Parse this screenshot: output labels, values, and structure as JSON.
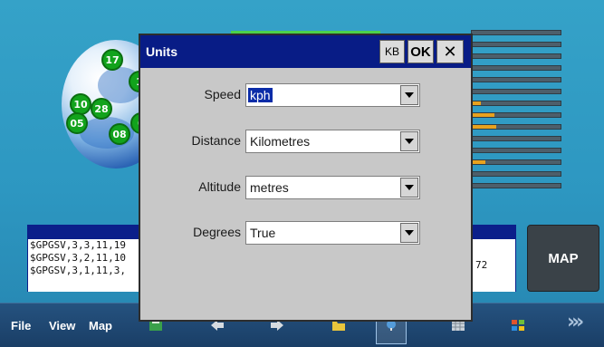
{
  "background": {
    "satellites": [
      {
        "id": "17"
      },
      {
        "id": "1"
      },
      {
        "id": "10"
      },
      {
        "id": "28"
      },
      {
        "id": "05"
      },
      {
        "id": "08"
      },
      {
        "id": "0"
      }
    ],
    "signal_bars": [
      0.0,
      0.0,
      0.0,
      0.0,
      0.0,
      0.0,
      0.1,
      0.25,
      0.28,
      0.0,
      0.0,
      0.15,
      0.0,
      0.0
    ],
    "nmea_lines": [
      "$GPGSV,3,3,11,19",
      "$GPGSV,3,2,11,10",
      "$GPGSV,3,1,11,3,"
    ],
    "nmea_right_fragment": "72",
    "map_button_label": "MAP"
  },
  "taskbar": {
    "menu_file": "File",
    "menu_view": "View",
    "menu_map": "Map"
  },
  "dialog": {
    "title": "Units",
    "kb_label": "KB",
    "ok_label": "OK",
    "close_label": "✕",
    "fields": [
      {
        "label": "Speed",
        "value": "kph"
      },
      {
        "label": "Distance",
        "value": "Kilometres"
      },
      {
        "label": "Altitude",
        "value": "metres"
      },
      {
        "label": "Degrees",
        "value": "True"
      }
    ]
  },
  "colors": {
    "titlebar": "#081c86",
    "background": "#35a2c8",
    "bar_fill": "#e8a21e",
    "satellite": "#12a31c"
  }
}
